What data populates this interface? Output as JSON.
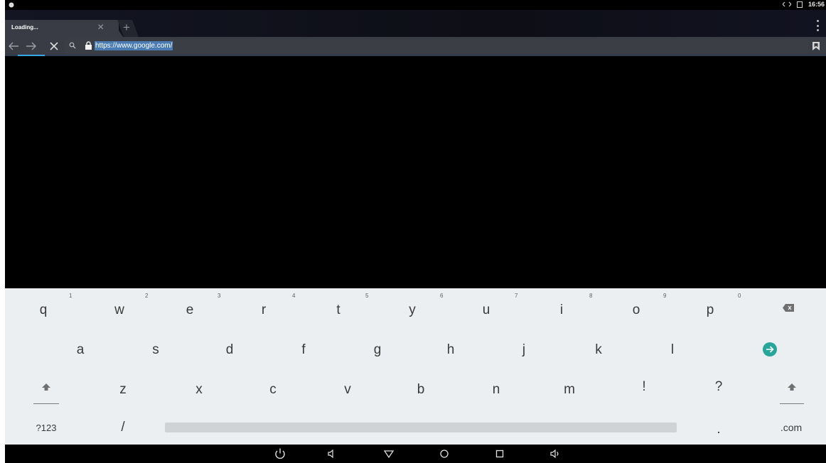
{
  "status_bar": {
    "time": "16:56"
  },
  "browser": {
    "tab": {
      "title": "Loading...",
      "close": "×"
    },
    "new_tab": "+",
    "url": "https://www.google.com/"
  },
  "keyboard": {
    "row1": [
      {
        "key": "q",
        "hint": "1"
      },
      {
        "key": "w",
        "hint": "2"
      },
      {
        "key": "e",
        "hint": "3"
      },
      {
        "key": "r",
        "hint": "4"
      },
      {
        "key": "t",
        "hint": "5"
      },
      {
        "key": "y",
        "hint": "6"
      },
      {
        "key": "u",
        "hint": "7"
      },
      {
        "key": "i",
        "hint": "8"
      },
      {
        "key": "o",
        "hint": "9"
      },
      {
        "key": "p",
        "hint": "0"
      }
    ],
    "row2": [
      "a",
      "s",
      "d",
      "f",
      "g",
      "h",
      "j",
      "k",
      "l"
    ],
    "row3": [
      "z",
      "x",
      "c",
      "v",
      "b",
      "n",
      "m",
      "!",
      "?"
    ],
    "symbols_label": "?123",
    "slash_label": "/",
    "period_label": ".",
    "dotcom_label": ".com",
    "accent_color": "#26a69a"
  }
}
